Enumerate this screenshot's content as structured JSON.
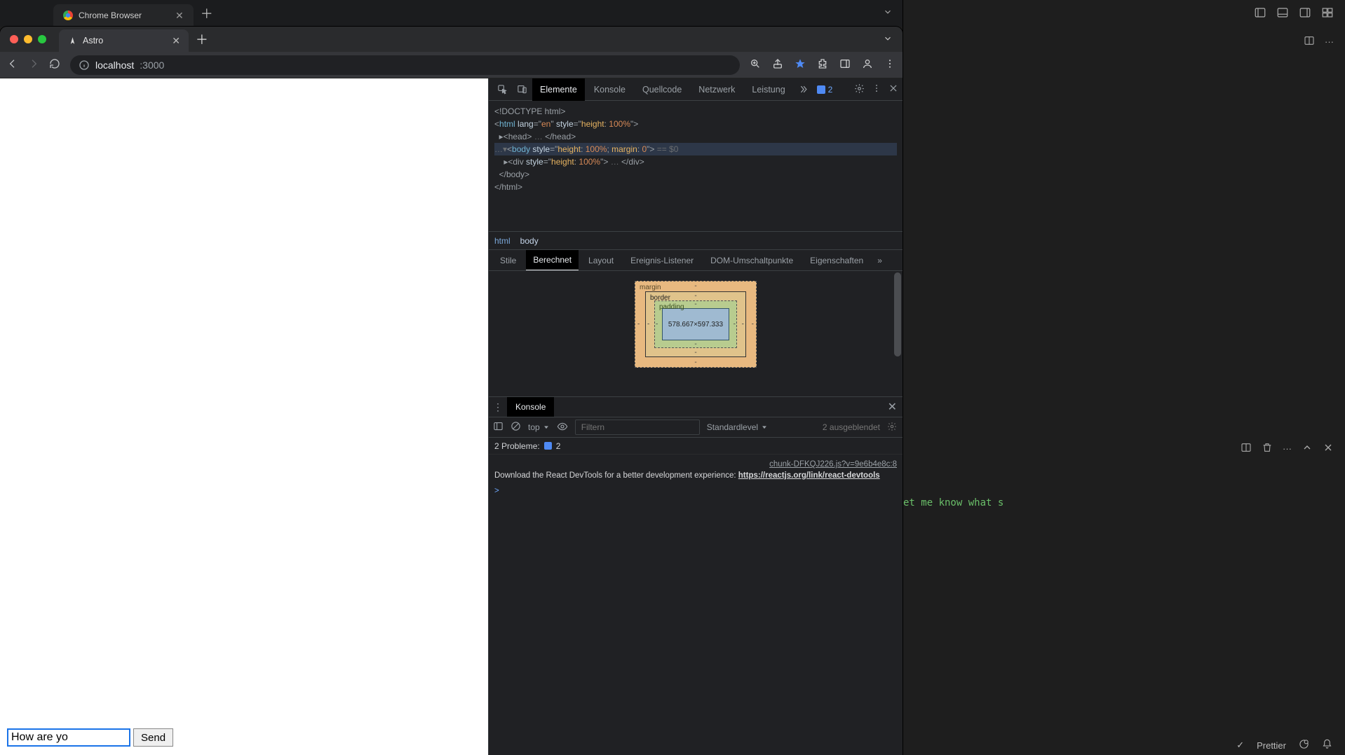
{
  "outer_tab": {
    "title": "Chrome Browser"
  },
  "browser_tab": {
    "title": "Astro"
  },
  "address": {
    "host": "localhost",
    "port": ":3000"
  },
  "page": {
    "input_value": "How are yo",
    "send_label": "Send"
  },
  "devtools": {
    "tabs": {
      "elements": "Elemente",
      "console": "Konsole",
      "source": "Quellcode",
      "network": "Netzwerk",
      "performance": "Leistung"
    },
    "issue_count": "2",
    "dom": {
      "l0": "<!DOCTYPE html>",
      "l1a": "<html ",
      "l1b": "lang",
      "l1c": "=\"",
      "l1d": "en",
      "l1e": "\" ",
      "l1f": "style",
      "l1g": "=\"",
      "l1h": "height: 100%",
      "l1i": "\">",
      "l2a": "  ▸<head>",
      "l2b": " … ",
      "l2c": "</head>",
      "l3pre": "…▾",
      "l3a": "<body ",
      "l3b": "style",
      "l3c": "=\"",
      "l3d": "height: 100%; ",
      "l3e": "margin: 0",
      "l3f": "\">",
      "l3g": " == $0",
      "l4a": "    ▸<div ",
      "l4b": "style",
      "l4c": "=\"",
      "l4d": "height: 100%",
      "l4e": "\">",
      "l4f": " … ",
      "l4g": "</div>",
      "l5": "  </body>",
      "l6": "</html>"
    },
    "breadcrumbs": {
      "a": "html",
      "b": "body"
    },
    "sub_tabs": {
      "styles": "Stile",
      "computed": "Berechnet",
      "layout": "Layout",
      "listeners": "Ereignis-Listener",
      "dombp": "DOM-Umschaltpunkte",
      "props": "Eigenschaften"
    },
    "box": {
      "margin": "margin",
      "border": "border",
      "padding": "padding",
      "content": "578.667×597.333",
      "dash": "-"
    },
    "drawer": {
      "tab": "Konsole",
      "context": "top",
      "filter_ph": "Filtern",
      "level": "Standardlevel",
      "hidden": "2 ausgeblendet",
      "problems_label": "2 Probleme:",
      "problems_count": "2",
      "src": "chunk-DFKQJ226.js?v=9e6b4e8c:8",
      "msg_a": "Download the React DevTools for a better development experience: ",
      "msg_link": "https://reactjs.org/link/react-devtools",
      "prompt": ">"
    }
  },
  "editor": {
    "terminal_text": "et me know what s",
    "status_prettier": "Prettier"
  }
}
